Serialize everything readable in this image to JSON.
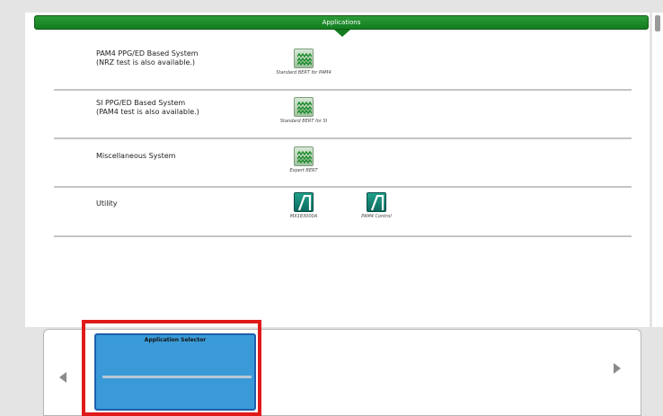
{
  "header": {
    "title": "Applications"
  },
  "sections": [
    {
      "label": "PAM4 PPG/ED Based System\n(NRZ test is also available.)",
      "apps": [
        {
          "caption": "Standard BERT for PAM4",
          "icon": "waveform-icon"
        }
      ]
    },
    {
      "label": "SI PPG/ED Based System\n(PAM4 test is also available.)",
      "apps": [
        {
          "caption": "Standard BERT for SI",
          "icon": "waveform-icon"
        }
      ]
    },
    {
      "label": "Miscellaneous System",
      "apps": [
        {
          "caption": "Expert BERT",
          "icon": "waveform-icon"
        }
      ]
    },
    {
      "label": "Utility",
      "apps": [
        {
          "caption": "MX183000A",
          "icon": "utility-slash-icon"
        },
        {
          "caption": "PAM4 Control",
          "icon": "utility-slash-icon"
        }
      ]
    }
  ],
  "selector": {
    "card_title": "Application Selector",
    "left_arrow": "left-arrow-icon",
    "right_arrow": "right-arrow-icon"
  },
  "colors": {
    "title_bar": "#137d1f",
    "card": "#3a9ad8",
    "highlight": "#e01a1a"
  }
}
